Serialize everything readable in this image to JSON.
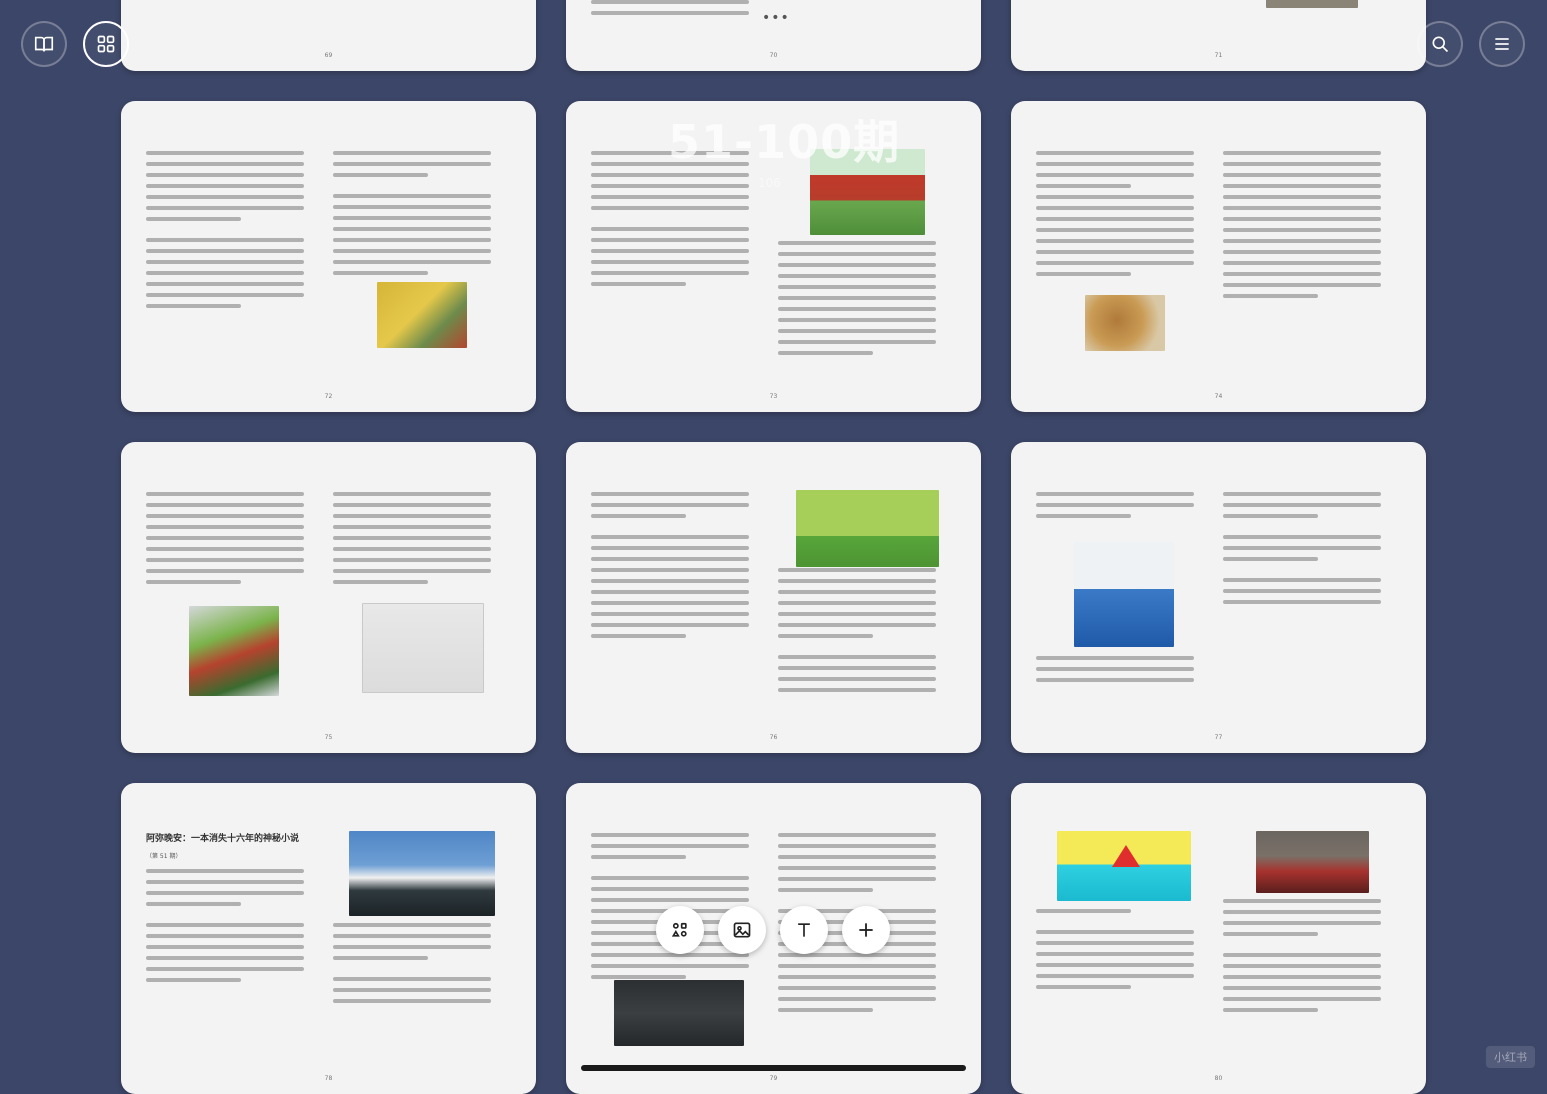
{
  "app": {
    "overlay_title": "51-100期",
    "overlay_subtitle": "106",
    "toolbar_dots": "•••",
    "watermark": "小红书"
  },
  "top_nav": {
    "library_icon": "book-icon",
    "grid_icon": "grid-icon",
    "search_icon": "search-icon",
    "menu_icon": "menu-icon"
  },
  "pages": [
    {
      "number": "69"
    },
    {
      "number": "70"
    },
    {
      "number": "71"
    },
    {
      "number": "72"
    },
    {
      "number": "73"
    },
    {
      "number": "74"
    },
    {
      "number": "75"
    },
    {
      "number": "76"
    },
    {
      "number": "77"
    },
    {
      "number": "78",
      "title": "阿弥晚安：一本消失十六年的神秘小说",
      "subtitle": "（第 51 期）"
    },
    {
      "number": "79"
    },
    {
      "number": "80"
    }
  ],
  "bottom_toolbar": {
    "shapes_icon": "shapes-icon",
    "image_icon": "image-icon",
    "text_icon": "text-icon",
    "add_icon": "plus-icon"
  },
  "colors": {
    "background": "#3c4668",
    "page": "#f3f3f3"
  }
}
